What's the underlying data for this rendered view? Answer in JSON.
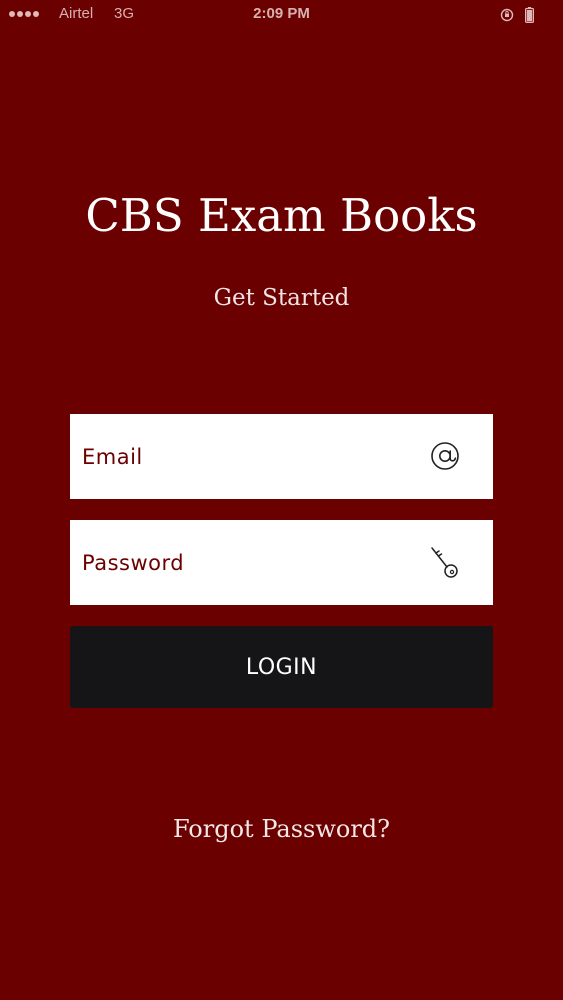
{
  "status_bar": {
    "carrier": "Airtel",
    "network": "3G",
    "time": "2:09 PM",
    "signal_bars": 4,
    "icons": [
      "orientation-lock-icon",
      "battery-icon"
    ]
  },
  "header": {
    "title": "CBS Exam Books",
    "subtitle": "Get Started"
  },
  "form": {
    "email": {
      "value": "",
      "placeholder": "Email",
      "icon": "at-sign-icon"
    },
    "password": {
      "value": "",
      "placeholder": "Password",
      "icon": "key-icon"
    },
    "login_label": "LOGIN"
  },
  "footer": {
    "forgot_label": "Forgot Password?"
  },
  "colors": {
    "background": "#6b0000",
    "button": "#151416",
    "field": "#ffffff",
    "field_text": "#6b0000"
  }
}
